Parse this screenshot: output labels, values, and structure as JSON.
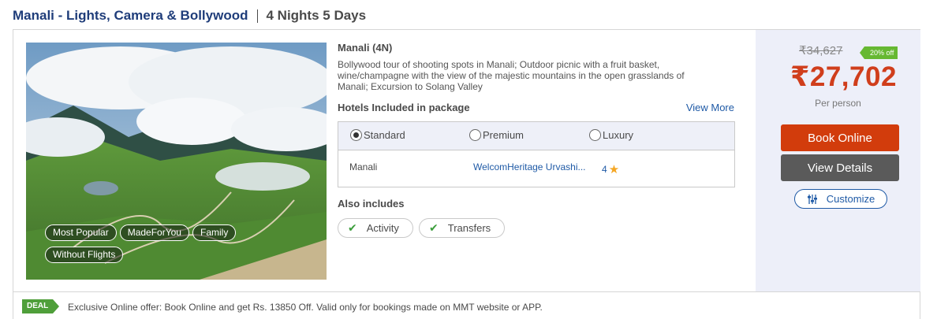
{
  "package": {
    "title": "Manali - Lights, Camera & Bollywood",
    "duration": "4 Nights 5 Days"
  },
  "tags": [
    "Most Popular",
    "MadeForYou",
    "Family",
    "Without Flights"
  ],
  "destination": {
    "title": "Manali (4N)",
    "description": "Bollywood tour of shooting spots in Manali; Outdoor picnic with a fruit basket, wine/champagne with the view of the majestic mountains in the open grasslands of Manali; Excursion to Solang Valley"
  },
  "hotels": {
    "heading": "Hotels Included in package",
    "view_more": "View More",
    "categories": [
      {
        "label": "Standard",
        "selected": true
      },
      {
        "label": "Premium",
        "selected": false
      },
      {
        "label": "Luxury",
        "selected": false
      }
    ],
    "rows": [
      {
        "city": "Manali",
        "hotel": "WelcomHeritage Urvashi...",
        "rating": "4"
      }
    ]
  },
  "also_includes": {
    "heading": "Also includes",
    "items": [
      "Activity",
      "Transfers"
    ]
  },
  "pricing": {
    "old_price": "₹34,627",
    "discount": "20% off",
    "price": "₹27,702",
    "per": "Per person",
    "book_label": "Book Online",
    "view_label": "View Details",
    "customize_label": "Customize"
  },
  "deal": {
    "badge": "DEAL",
    "text": "Exclusive Online offer: Book Online and get Rs. 13850 Off. Valid only for bookings made on MMT website or APP."
  },
  "colors": {
    "title": "#1f3d7a",
    "link": "#1f5aa6",
    "price": "#d03e1c",
    "book_button": "#d23c0c",
    "view_button": "#5a5a5a",
    "discount_badge": "#66b832",
    "deal_badge": "#4f9f3a",
    "price_panel_bg": "#edeff9"
  },
  "icons": {
    "rating": "star-icon",
    "included": "check-icon",
    "customize": "sliders-icon",
    "radio": "radio-button"
  }
}
